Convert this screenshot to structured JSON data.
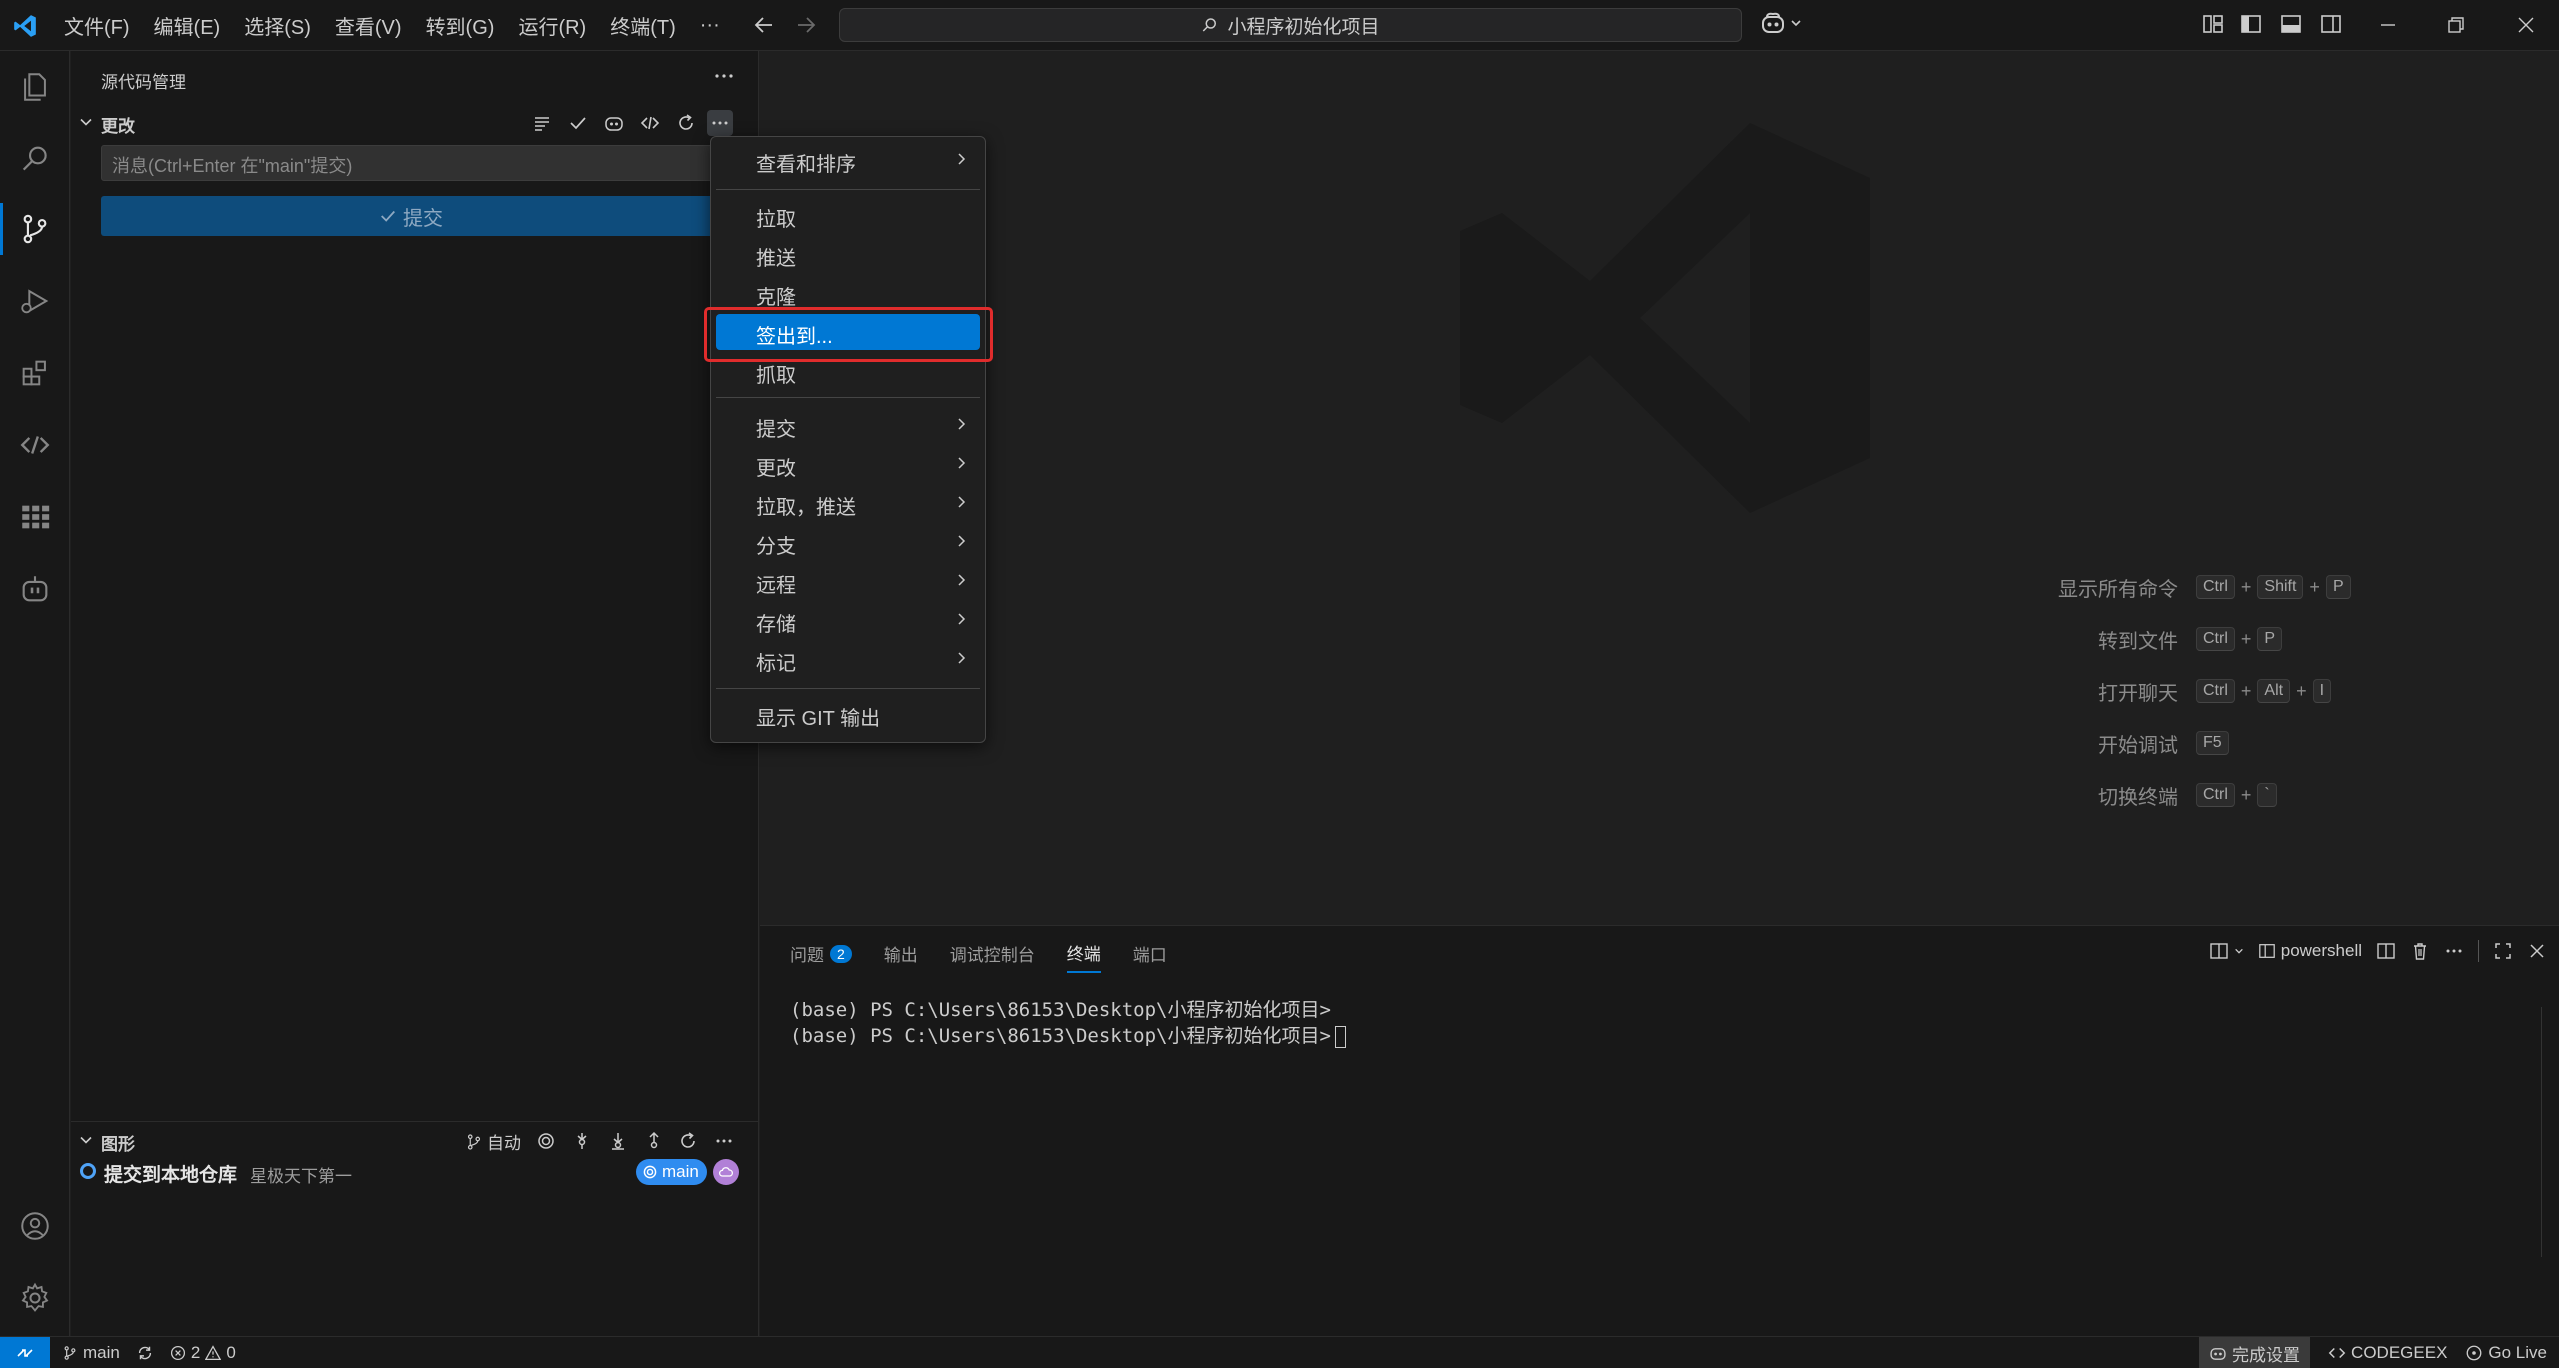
{
  "titlebar": {
    "menu": [
      "文件(F)",
      "编辑(E)",
      "选择(S)",
      "查看(V)",
      "转到(G)",
      "运行(R)",
      "终端(T)",
      "···"
    ],
    "search_text": "小程序初始化项目"
  },
  "sidebar": {
    "title": "源代码管理",
    "changes_title": "更改",
    "commit_placeholder": "消息(Ctrl+Enter 在\"main\"提交)",
    "commit_label": "提交",
    "graph_title": "图形",
    "graph_auto": "自动",
    "graph_commit_message": "提交到本地仓库",
    "graph_commit_author": "星极天下第一",
    "branch": "main"
  },
  "context_menu": {
    "items": [
      {
        "label": "查看和排序",
        "submenu": true
      },
      {
        "label": "拉取",
        "submenu": false
      },
      {
        "label": "推送",
        "submenu": false
      },
      {
        "label": "克隆",
        "submenu": false
      },
      {
        "label": "签出到...",
        "submenu": false,
        "highlighted": true
      },
      {
        "label": "抓取",
        "submenu": false
      },
      {
        "label": "提交",
        "submenu": true
      },
      {
        "label": "更改",
        "submenu": true
      },
      {
        "label": "拉取，推送",
        "submenu": true
      },
      {
        "label": "分支",
        "submenu": true
      },
      {
        "label": "远程",
        "submenu": true
      },
      {
        "label": "存储",
        "submenu": true
      },
      {
        "label": "标记",
        "submenu": true
      },
      {
        "label": "显示 GIT 输出",
        "submenu": false
      }
    ]
  },
  "editor": {
    "shortcuts": [
      {
        "label": "显示所有命令",
        "keys": [
          "Ctrl",
          "Shift",
          "P"
        ]
      },
      {
        "label": "转到文件",
        "keys": [
          "Ctrl",
          "P"
        ]
      },
      {
        "label": "打开聊天",
        "keys": [
          "Ctrl",
          "Alt",
          "I"
        ]
      },
      {
        "label": "开始调试",
        "keys": [
          "F5"
        ]
      },
      {
        "label": "切换终端",
        "keys": [
          "Ctrl",
          "`"
        ]
      }
    ]
  },
  "panel": {
    "tabs": [
      "问题",
      "输出",
      "调试控制台",
      "终端",
      "端口"
    ],
    "problems_count": "2",
    "active_tab": "终端",
    "shell": "powershell",
    "terminal_lines": [
      "(base) PS C:\\Users\\86153\\Desktop\\小程序初始化项目>",
      "(base) PS C:\\Users\\86153\\Desktop\\小程序初始化项目>"
    ]
  },
  "statusbar": {
    "branch": "main",
    "errors": "2",
    "warnings": "0",
    "setup": "完成设置",
    "codegeex": "CODEGEEX",
    "golive": "Go Live"
  },
  "colors": {
    "accent": "#0078d4",
    "highlight_border": "#e02c2c",
    "branch_badge": "#2f8cf0",
    "remote_badge": "#b180d7"
  }
}
